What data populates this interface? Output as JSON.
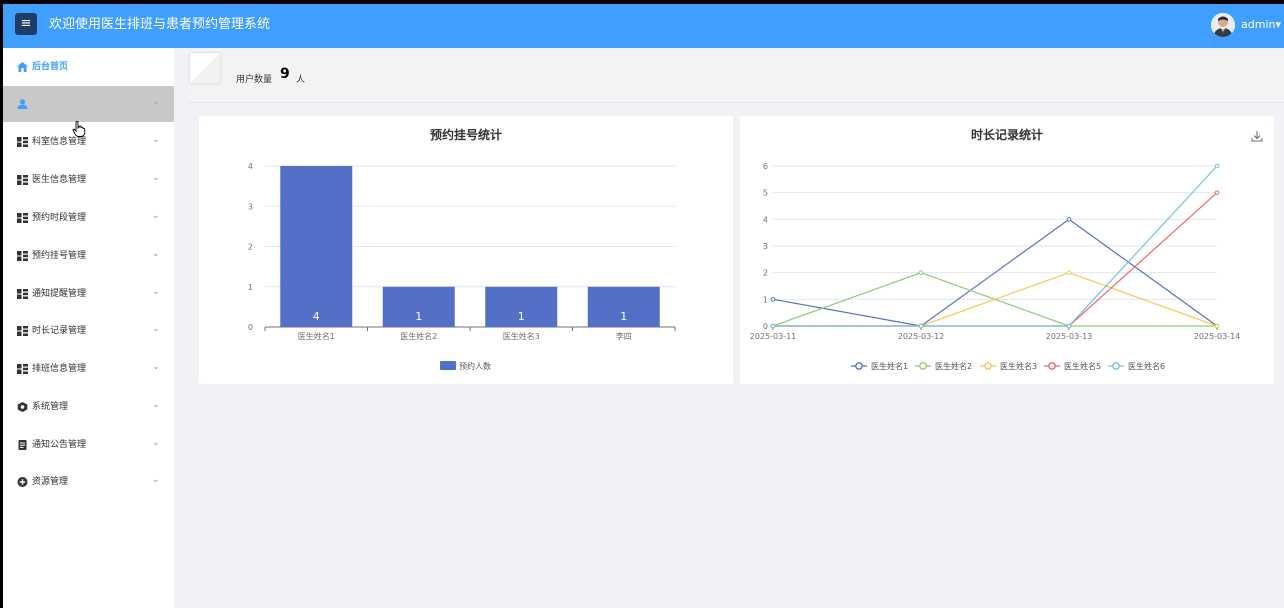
{
  "header": {
    "menu_icon": "hamburger-icon",
    "title": "欢迎使用医生排班与患者预约管理系统",
    "user": "admin",
    "user_caret": "▾"
  },
  "sidebar": {
    "items": [
      {
        "label": "后台首页",
        "icon": "home-icon"
      },
      {
        "label": "",
        "icon": "user-icon"
      },
      {
        "label": "科室信息管理",
        "icon": "grid-icon"
      },
      {
        "label": "医生信息管理",
        "icon": "grid-icon"
      },
      {
        "label": "预约时段管理",
        "icon": "grid-icon"
      },
      {
        "label": "预约挂号管理",
        "icon": "grid-icon"
      },
      {
        "label": "通知提醒管理",
        "icon": "grid-icon"
      },
      {
        "label": "时长记录管理",
        "icon": "grid-icon"
      },
      {
        "label": "排班信息管理",
        "icon": "grid-icon"
      },
      {
        "label": "系统管理",
        "icon": "gear-icon"
      },
      {
        "label": "通知公告管理",
        "icon": "document-icon"
      },
      {
        "label": "资源管理",
        "icon": "plus-circle-icon"
      }
    ],
    "chevron": "⌄"
  },
  "stats": {
    "label": "用户数量",
    "value": "9",
    "unit": "人"
  },
  "colors": {
    "header": "#409eff",
    "bar": "#5470c6"
  },
  "chart_data": [
    {
      "type": "bar",
      "title": "预约挂号统计",
      "categories": [
        "医生姓名1",
        "医生姓名2",
        "医生姓名3",
        "李四"
      ],
      "series": [
        {
          "name": "预约人数",
          "values": [
            4,
            1,
            1,
            1
          ]
        }
      ],
      "ylim": [
        0,
        4
      ],
      "yticks": [
        0,
        1,
        2,
        3,
        4
      ],
      "grid": true,
      "legend": "bottom"
    },
    {
      "type": "line",
      "title": "时长记录统计",
      "categories": [
        "2025-03-11",
        "2025-03-12",
        "2025-03-13",
        "2025-03-14"
      ],
      "series": [
        {
          "name": "医生姓名1",
          "color": "#5470c6",
          "values": [
            1,
            0,
            4,
            0
          ]
        },
        {
          "name": "医生姓名2",
          "color": "#91cc75",
          "values": [
            0,
            2,
            0,
            0
          ]
        },
        {
          "name": "医生姓名3",
          "color": "#fac858",
          "values": [
            0,
            0,
            2,
            0
          ]
        },
        {
          "name": "医生姓名5",
          "color": "#ee6666",
          "values": [
            0,
            0,
            0,
            5
          ]
        },
        {
          "name": "医生姓名6",
          "color": "#73c0de",
          "values": [
            0,
            0,
            0,
            6
          ]
        }
      ],
      "ylim": [
        0,
        6
      ],
      "yticks": [
        0,
        1,
        2,
        3,
        4,
        5,
        6
      ],
      "grid": true,
      "legend": "bottom",
      "toolbox_icon": "download-icon"
    }
  ]
}
